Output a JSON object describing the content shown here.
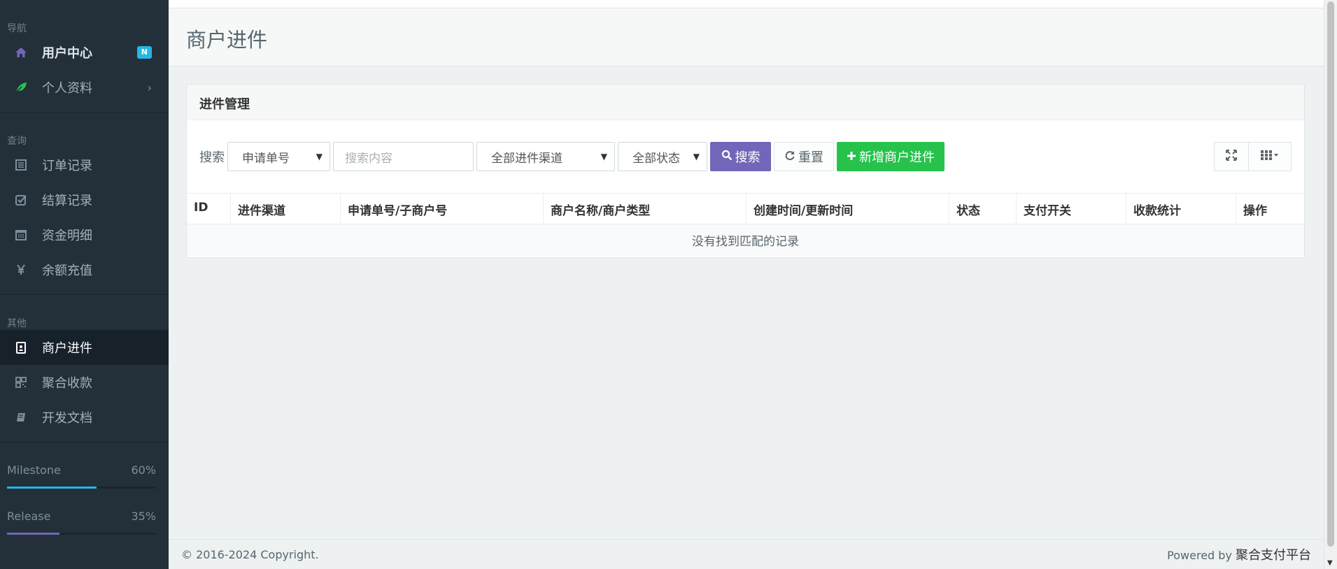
{
  "sidebar": {
    "sections": [
      {
        "heading": "导航",
        "items": [
          {
            "label": "用户中心",
            "icon": "home-icon",
            "badge": "N",
            "strong": true
          },
          {
            "label": "个人资料",
            "icon": "leaf-icon",
            "has_chevron": true
          }
        ]
      },
      {
        "heading": "查询",
        "items": [
          {
            "label": "订单记录",
            "icon": "list-icon"
          },
          {
            "label": "结算记录",
            "icon": "check-square-icon"
          },
          {
            "label": "资金明细",
            "icon": "calendar-icon"
          },
          {
            "label": "余额充值",
            "icon": "yen-icon"
          }
        ]
      },
      {
        "heading": "其他",
        "items": [
          {
            "label": "商户进件",
            "icon": "id-badge-icon",
            "active": true
          },
          {
            "label": "聚合收款",
            "icon": "qrcode-icon"
          },
          {
            "label": "开发文档",
            "icon": "book-icon"
          }
        ]
      }
    ],
    "chevron": "›",
    "progress": [
      {
        "label": "Milestone",
        "percent_text": "60%",
        "value": 0.6,
        "color": "#23b7e5"
      },
      {
        "label": "Release",
        "percent_text": "35%",
        "value": 0.35,
        "color": "#7266ba"
      }
    ]
  },
  "page": {
    "title": "商户进件"
  },
  "panel": {
    "heading": "进件管理",
    "search_label": "搜索",
    "order_type_select": "申请单号",
    "search_placeholder": "搜索内容",
    "channel_select": "全部进件渠道",
    "status_select": "全部状态",
    "search_button": "搜索",
    "reset_button": "重置",
    "add_button": "新增商户进件"
  },
  "table": {
    "columns": [
      "ID",
      "进件渠道",
      "申请单号/子商户号",
      "商户名称/商户类型",
      "创建时间/更新时间",
      "状态",
      "支付开关",
      "收款统计",
      "操作"
    ],
    "empty_text": "没有找到匹配的记录"
  },
  "footer": {
    "copyright": "© 2016-2024 Copyright.",
    "powered_prefix": "Powered by",
    "powered_brand": "聚合支付平台"
  },
  "colors": {
    "accent_purple": "#7266ba",
    "accent_green": "#27c24c",
    "accent_blue": "#23b7e5",
    "sidebar_bg": "#23303a"
  }
}
